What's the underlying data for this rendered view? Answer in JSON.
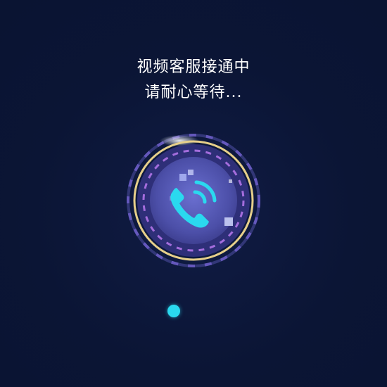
{
  "call_status": {
    "title": "视频客服接通中",
    "subtitle": "请耐心等待..."
  },
  "emblem": {
    "icon": "phone-ringing-icon",
    "colors": {
      "background": "#0b1535",
      "outer_ring": "#6f5ec9",
      "gold_ring": "#e6cf8a",
      "inner_disc": "#4c4fa8",
      "dashed_ring": "#b174e8",
      "phone": "#2ad9ef"
    }
  },
  "loading": {
    "dot_color": "#2ad9ef"
  }
}
